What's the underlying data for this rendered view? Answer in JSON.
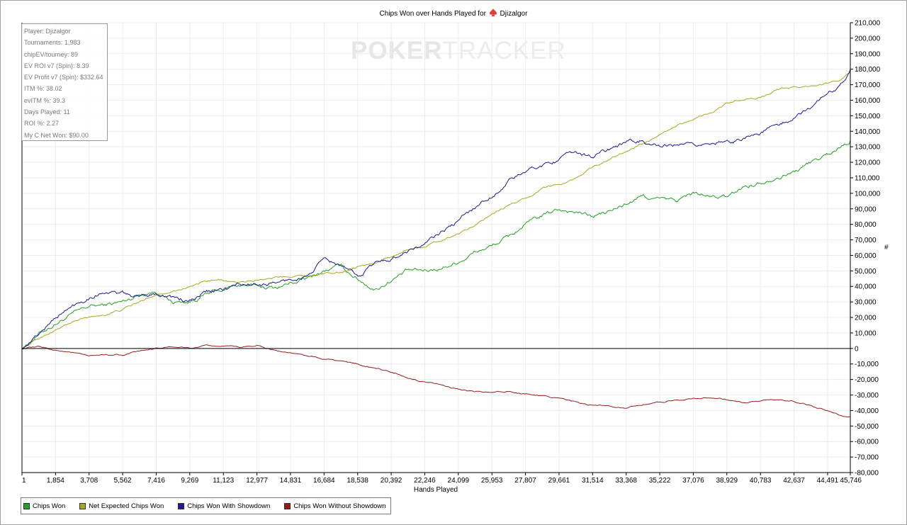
{
  "header": {
    "title_prefix": "Chips Won over Hands Played for",
    "player": "Djizalgor",
    "spade_icon": "spade-icon"
  },
  "watermark": {
    "part1": "POKER",
    "part2": "TRACKER"
  },
  "stats": [
    "Player: Djizalgor",
    "Tournaments: 1,983",
    "chipEV/tourney: 89",
    "EV ROI v7 (Spin): 8.39",
    "EV Profit v7 (Spin): $332.64",
    "ITM %: 38.02",
    "evITM %: 39.3",
    "Days Played: 11",
    "ROI %: 2.27",
    "My C Net Won: $90.00"
  ],
  "chart_data": {
    "type": "line",
    "title": "Chips Won over Hands Played for Djizalgor",
    "xlabel": "Hands Played",
    "ylabel": "#",
    "xlim": [
      1,
      45746
    ],
    "ylim": [
      -80000,
      210000
    ],
    "x_ticks": [
      "1",
      "1,854",
      "3,708",
      "5,562",
      "7,416",
      "9,269",
      "11,123",
      "12,977",
      "14,831",
      "16,684",
      "18,538",
      "20,392",
      "22,246",
      "24,099",
      "25,953",
      "27,807",
      "29,661",
      "31,514",
      "33,368",
      "35,222",
      "37,076",
      "38,929",
      "40,783",
      "42,637",
      "44,491",
      "45,746"
    ],
    "y_ticks": [
      "210,000",
      "200,000",
      "190,000",
      "180,000",
      "170,000",
      "160,000",
      "150,000",
      "140,000",
      "130,000",
      "120,000",
      "110,000",
      "100,000",
      "90,000",
      "80,000",
      "70,000",
      "60,000",
      "50,000",
      "40,000",
      "30,000",
      "20,000",
      "10,000",
      "0",
      "-10,000",
      "-20,000",
      "-30,000",
      "-40,000",
      "-50,000",
      "-60,000",
      "-70,000",
      "-80,000"
    ],
    "grid": true,
    "legend_position": "bottom-left",
    "x": [
      1,
      1000,
      1854,
      2800,
      3708,
      4600,
      5562,
      6500,
      7416,
      8300,
      9269,
      10200,
      11123,
      12000,
      12977,
      13900,
      14831,
      15800,
      16684,
      17600,
      18538,
      19500,
      20392,
      21300,
      22246,
      23200,
      24099,
      25000,
      25953,
      26900,
      27807,
      28700,
      29661,
      30600,
      31514,
      32400,
      33368,
      34300,
      35222,
      36100,
      37076,
      38000,
      38929,
      39800,
      40783,
      41700,
      42637,
      43600,
      44491,
      45200,
      45746
    ],
    "series": [
      {
        "name": "Chips Won",
        "color": "#22a022",
        "values": [
          0,
          10000,
          16000,
          22000,
          27000,
          28000,
          30000,
          35000,
          37000,
          30000,
          30000,
          35000,
          38000,
          41000,
          40000,
          39000,
          42000,
          45000,
          50000,
          53000,
          45000,
          38000,
          44000,
          50000,
          50000,
          52000,
          56000,
          62000,
          66000,
          72000,
          80000,
          85000,
          90000,
          88000,
          85000,
          88000,
          93000,
          98000,
          96000,
          95000,
          100000,
          98000,
          97000,
          104000,
          107000,
          111000,
          114000,
          120000,
          125000,
          130000,
          134000
        ]
      },
      {
        "name": "Net Expected Chips Won",
        "color": "#a8a820",
        "values": [
          0,
          7000,
          12000,
          17000,
          20000,
          22000,
          25000,
          30000,
          35000,
          37000,
          40000,
          43000,
          44000,
          42000,
          44000,
          46000,
          47000,
          47000,
          48000,
          49000,
          53000,
          55000,
          59000,
          64000,
          66000,
          70000,
          74000,
          80000,
          86000,
          92000,
          97000,
          103000,
          106000,
          110000,
          117000,
          122000,
          127000,
          132000,
          137000,
          143000,
          148000,
          152000,
          158000,
          160000,
          162000,
          167000,
          168000,
          169000,
          171000,
          173000,
          178000
        ]
      },
      {
        "name": "Chips Won With Showdown",
        "color": "#1a1a9a",
        "values": [
          0,
          10000,
          20000,
          27000,
          33000,
          37000,
          35000,
          33000,
          36000,
          33000,
          30000,
          36000,
          38000,
          41000,
          41000,
          42000,
          44000,
          47000,
          57000,
          53000,
          47000,
          55000,
          58000,
          63000,
          67000,
          75000,
          82000,
          91000,
          98000,
          108000,
          114000,
          118000,
          122000,
          126000,
          124000,
          128000,
          133000,
          134000,
          129000,
          131000,
          130000,
          133000,
          132000,
          136000,
          139000,
          144000,
          148000,
          156000,
          165000,
          170000,
          180000
        ]
      },
      {
        "name": "Chips Won Without Showdown",
        "color": "#9a1a1a",
        "values": [
          0,
          1000,
          -1000,
          -3000,
          -5000,
          -4000,
          -4000,
          -2000,
          0,
          1000,
          0,
          1500,
          1500,
          500,
          2000,
          -1000,
          -3000,
          -5000,
          -7000,
          -8000,
          -10000,
          -13000,
          -15000,
          -19000,
          -22000,
          -24000,
          -26000,
          -28000,
          -28500,
          -28000,
          -29000,
          -30000,
          -32000,
          -35000,
          -37000,
          -37000,
          -38000,
          -36000,
          -35000,
          -33000,
          -32000,
          -32000,
          -33000,
          -35000,
          -34000,
          -33000,
          -34000,
          -37000,
          -40000,
          -43000,
          -44000
        ]
      }
    ]
  },
  "legend": [
    "Chips Won",
    "Net Expected Chips Won",
    "Chips Won With Showdown",
    "Chips Won Without Showdown"
  ]
}
